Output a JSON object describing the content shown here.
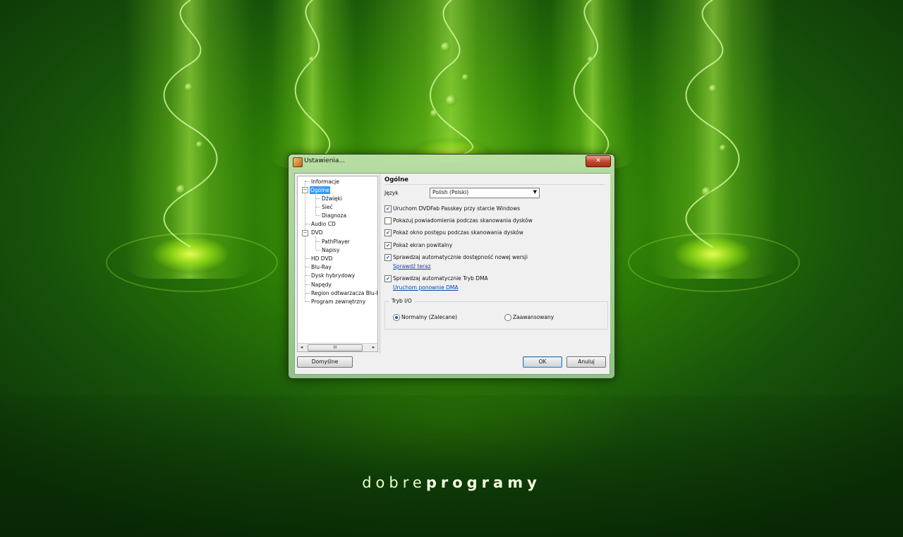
{
  "window": {
    "title": "Ustawienia...",
    "close_glyph": "✕"
  },
  "tree": {
    "items": [
      {
        "label": "Informacje"
      },
      {
        "label": "Ogólne",
        "selected": true
      },
      {
        "label": "Dźwięki"
      },
      {
        "label": "Sieć"
      },
      {
        "label": "Diagnoza"
      },
      {
        "label": "Audio CD"
      },
      {
        "label": "DVD"
      },
      {
        "label": "PathPlayer"
      },
      {
        "label": "Napisy"
      },
      {
        "label": "HD DVD"
      },
      {
        "label": "Blu-Ray"
      },
      {
        "label": "Dysk hybrydowy"
      },
      {
        "label": "Napędy"
      },
      {
        "label": "Region odtwarzacza Blu-R"
      },
      {
        "label": "Program zewnętrzny"
      }
    ],
    "collapse_glyph": "−",
    "scroll_left": "◂",
    "scroll_right": "▸",
    "scroll_thumb": "III"
  },
  "general": {
    "section_title": "Ogólne",
    "language_label": "Język",
    "language_value": "Polish (Polski)",
    "dropdown_glyph": "▼",
    "options": [
      {
        "label": "Uruchom DVDFab Passkey przy starcie Windows",
        "checked": true
      },
      {
        "label": "Pokazuj powiadomienia podczas skanowania dysków",
        "checked": false
      },
      {
        "label": "Pokaż okno postępu podczas skanowania dysków",
        "checked": true
      },
      {
        "label": "Pokaż ekran powitalny",
        "checked": true
      },
      {
        "label": "Sprawdzaj automatycznie dostępność nowej wersji",
        "checked": true
      },
      {
        "label": "Sprawdzaj automatycznie Tryb DMA",
        "checked": true
      }
    ],
    "check_glyph": "✔",
    "check_now_link": "Sprawdź teraz",
    "restart_dma_link": "Uruchom ponownie DMA",
    "io_mode": {
      "title": "Tryb I/O",
      "normal": {
        "label": "Normalny (Zalecane)",
        "selected": true
      },
      "advanced": {
        "label": "Zaawansowany",
        "selected": false
      }
    }
  },
  "buttons": {
    "defaults": "Domyślne",
    "ok": "OK",
    "cancel": "Anuluj"
  },
  "branding": {
    "light": "dobre",
    "bold": "programy"
  }
}
